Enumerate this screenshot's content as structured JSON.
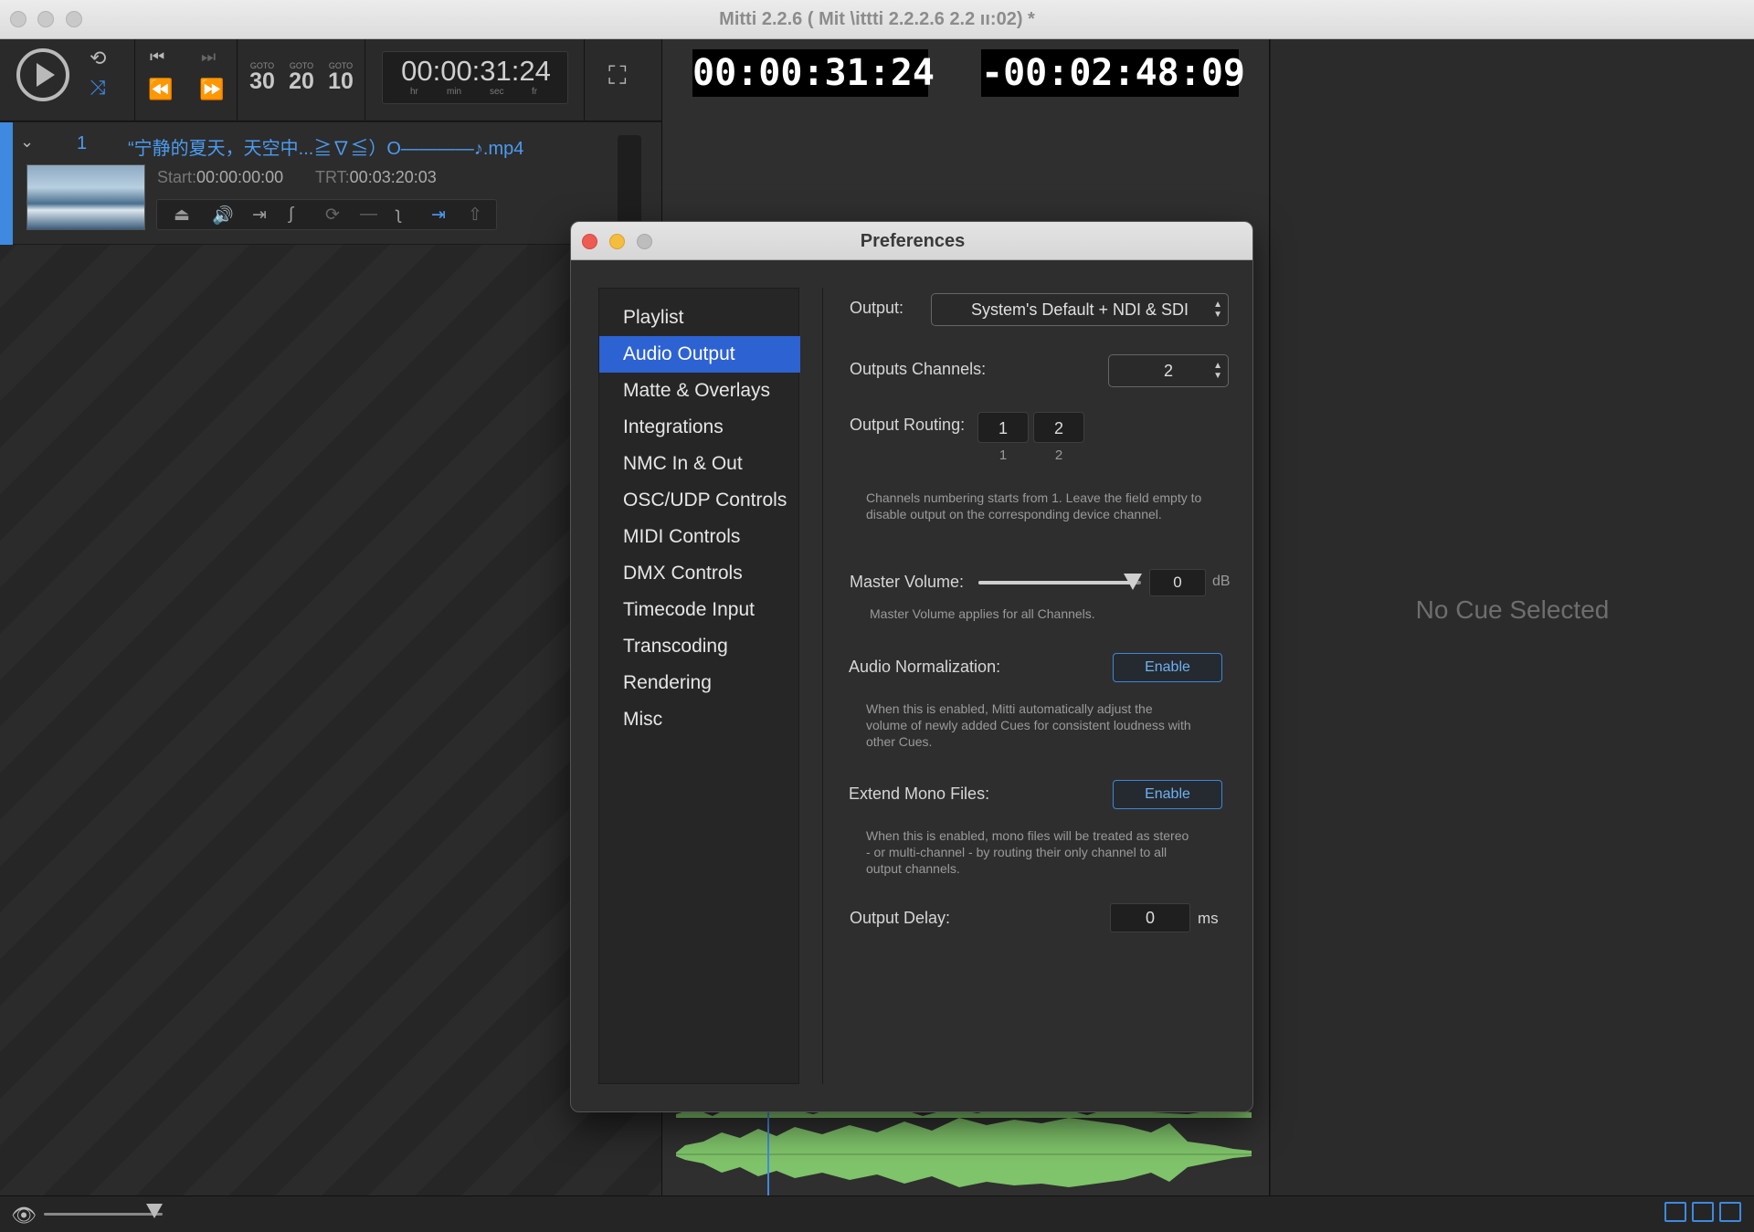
{
  "window": {
    "title": "Mitti 2.2.6 (      Mit \\ittti 2.2.2.6      2.2 ıı:02) *"
  },
  "toolbar": {
    "goto": [
      {
        "label": "GOTO",
        "value": "30"
      },
      {
        "label": "GOTO",
        "value": "20"
      },
      {
        "label": "GOTO",
        "value": "10"
      }
    ],
    "timecode": {
      "value": "00:00:31:24",
      "units": [
        "hr",
        "min",
        "sec",
        "fr"
      ]
    }
  },
  "cue": {
    "index": "1",
    "title": "“宁静的夏天，天空中...≧∇≦）O————♪.mp4",
    "start_label": "Start:",
    "start_value": "00:00:00:00",
    "trt_label": "TRT:",
    "trt_value": "00:03:20:03"
  },
  "clocks": {
    "elapsed": "00:00:31:24",
    "remaining": "-00:02:48:09"
  },
  "inspector": {
    "empty_text": "No Cue Selected"
  },
  "preferences": {
    "title": "Preferences",
    "sidebar": [
      {
        "label": "Playlist",
        "selected": false
      },
      {
        "label": "Audio Output",
        "selected": true
      },
      {
        "label": "Matte & Overlays",
        "selected": false
      },
      {
        "label": "Integrations",
        "selected": false
      },
      {
        "label": "NMC In & Out",
        "selected": false
      },
      {
        "label": "OSC/UDP Controls",
        "selected": false
      },
      {
        "label": "MIDI Controls",
        "selected": false
      },
      {
        "label": "DMX Controls",
        "selected": false
      },
      {
        "label": "Timecode Input",
        "selected": false
      },
      {
        "label": "Transcoding",
        "selected": false
      },
      {
        "label": "Rendering",
        "selected": false
      },
      {
        "label": "Misc",
        "selected": false
      }
    ],
    "audio_output": {
      "output_label": "Output:",
      "output_value": "System's Default + NDI & SDI",
      "channels_label": "Outputs Channels:",
      "channels_value": "2",
      "routing_label": "Output Routing:",
      "routing": [
        {
          "value": "1",
          "channel": "1"
        },
        {
          "value": "2",
          "channel": "2"
        }
      ],
      "routing_note": "Channels numbering starts from 1. Leave the field empty to disable output on the corresponding device channel.",
      "master_label": "Master Volume:",
      "master_value": "0",
      "master_unit": "dB",
      "master_level": 0.95,
      "master_note": "Master Volume applies for all Channels.",
      "normalization_label": "Audio Normalization:",
      "normalization_button": "Enable",
      "normalization_note": "When this is enabled, Mitti automatically adjust the volume of newly added Cues for consistent loudness with other Cues.",
      "mono_label": "Extend Mono Files:",
      "mono_button": "Enable",
      "mono_note": "When this is enabled, mono files will be treated as stereo - or multi-channel - by routing their only channel to all output channels.",
      "delay_label": "Output Delay:",
      "delay_value": "0",
      "delay_unit": "ms"
    }
  },
  "colors": {
    "accent": "#3d8ae0",
    "selection": "#2d62d3",
    "waveform": "#7fc36a"
  }
}
